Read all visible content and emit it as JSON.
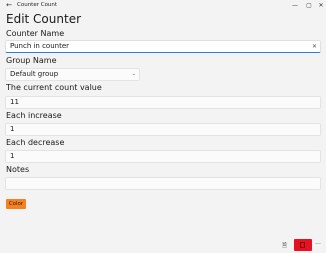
{
  "window": {
    "title": "Counter Count",
    "back_glyph": "←",
    "minimize_glyph": "—",
    "maximize_glyph": "▢",
    "close_glyph": "✕"
  },
  "page": {
    "title": "Edit Counter"
  },
  "form": {
    "name": {
      "label": "Counter Name",
      "value": "Punch in counter",
      "clear_glyph": "✕"
    },
    "group": {
      "label": "Group Name",
      "value": "Default group",
      "chevron_glyph": "⌄"
    },
    "current_count": {
      "label": "The current count value",
      "value": "11"
    },
    "increase": {
      "label": "Each increase",
      "value": "1"
    },
    "decrease": {
      "label": "Each decrease",
      "value": "1"
    },
    "notes": {
      "label": "Notes",
      "value": ""
    },
    "color_button": {
      "label": "Color",
      "color": "#f7811e"
    }
  },
  "footer": {
    "save_glyph": "🗎",
    "more_glyph": "···",
    "delete_color": "#e81123"
  },
  "icons": [
    "back-arrow-icon",
    "minimize-icon",
    "maximize-icon",
    "close-icon",
    "clear-icon",
    "chevron-down-icon",
    "save-icon",
    "trash-icon",
    "more-icon"
  ]
}
